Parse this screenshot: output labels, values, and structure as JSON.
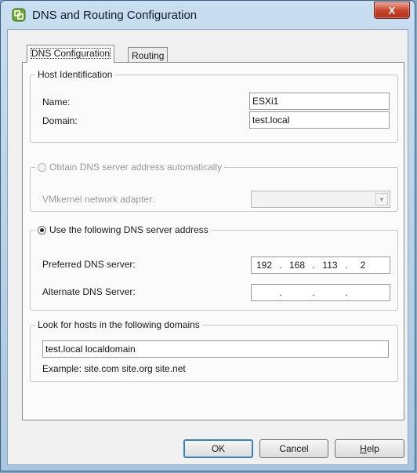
{
  "window": {
    "title": "DNS and Routing Configuration",
    "close_glyph": "X"
  },
  "tabs": [
    {
      "label": "DNS Configuration",
      "active": true
    },
    {
      "label": "Routing",
      "active": false
    }
  ],
  "host_identification": {
    "legend": "Host Identification",
    "name_label": "Name:",
    "name_value": "ESXi1",
    "domain_label": "Domain:",
    "domain_value": "test.local"
  },
  "dns_auto": {
    "legend": "Obtain DNS server address automatically",
    "adapter_label": "VMkernel network adapter:",
    "selected": false,
    "enabled": false
  },
  "dns_manual": {
    "legend": "Use the following DNS server address",
    "selected": true,
    "preferred_label": "Preferred DNS server:",
    "preferred_octets": [
      "192",
      "168",
      "113",
      "2"
    ],
    "alternate_label": "Alternate DNS Server:",
    "alternate_octets": [
      "",
      "",
      "",
      ""
    ],
    "dot": "."
  },
  "search_domains": {
    "legend": "Look for hosts in the following domains",
    "value": "test.local localdomain",
    "example": "Example: site.com site.org site.net"
  },
  "buttons": {
    "ok": "OK",
    "cancel": "Cancel",
    "help_mnemonic": "H",
    "help_rest": "elp"
  },
  "colors": {
    "accent": "#3c7fb1",
    "close": "#c9462e",
    "title_bg": "#b9d2ea"
  }
}
